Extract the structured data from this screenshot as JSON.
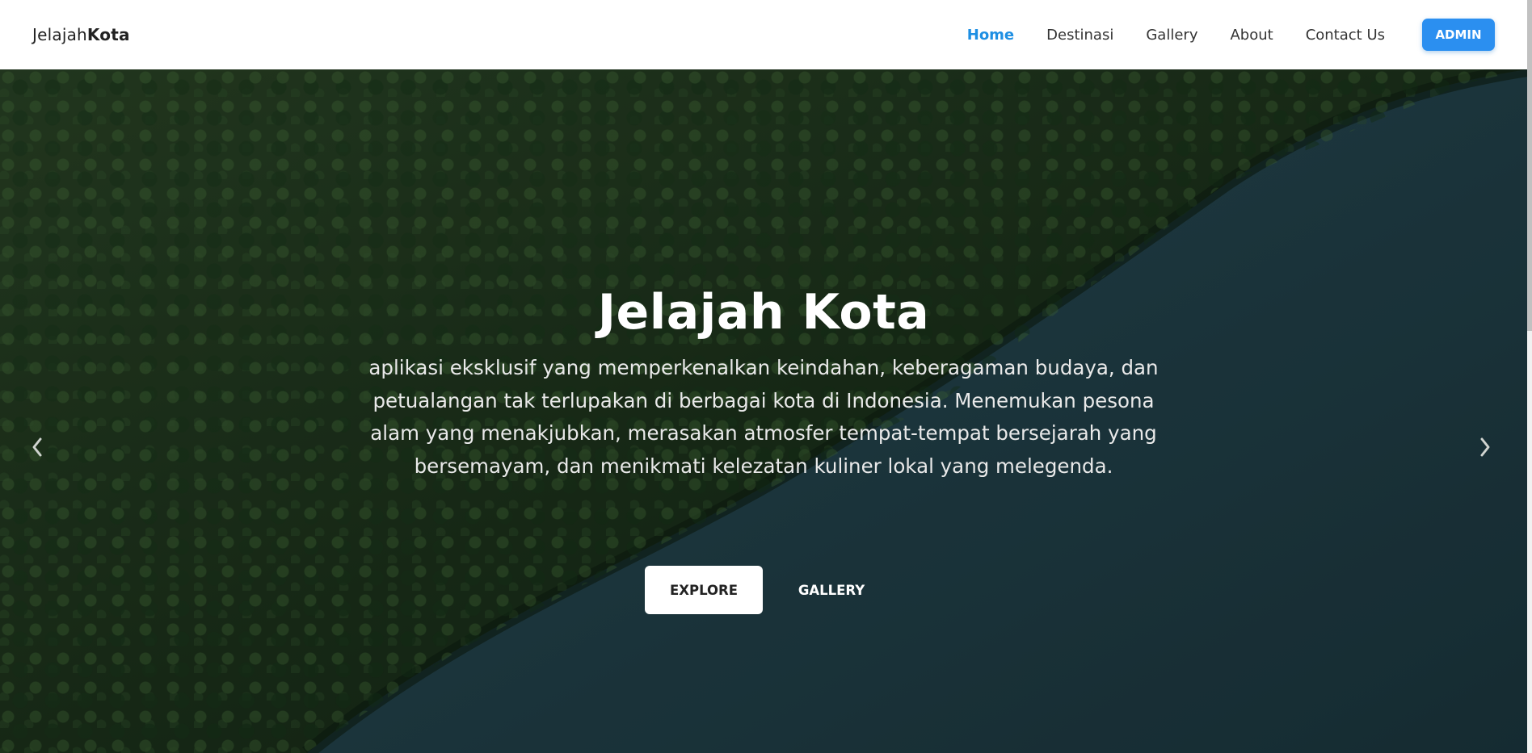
{
  "brand": {
    "prefix": "Jelajah",
    "bold": "Kota"
  },
  "nav": {
    "items": [
      {
        "label": "Home",
        "active": true
      },
      {
        "label": "Destinasi",
        "active": false
      },
      {
        "label": "Gallery",
        "active": false
      },
      {
        "label": "About",
        "active": false
      },
      {
        "label": "Contact Us",
        "active": false
      }
    ],
    "admin_label": "ADMIN"
  },
  "hero": {
    "title": "Jelajah Kota",
    "description": "aplikasi eksklusif yang memperkenalkan keindahan, keberagaman budaya, dan petualangan tak terlupakan di berbagai kota di Indonesia. Menemukan pesona alam yang menakjubkan, merasakan atmosfer tempat-tempat bersejarah yang bersemayam, dan menikmati kelezatan kuliner lokal yang melegenda.",
    "explore_label": "EXPLORE",
    "gallery_label": "GALLERY"
  },
  "carousel": {
    "prev_icon": "chevron-left-icon",
    "next_icon": "chevron-right-icon"
  },
  "colors": {
    "accent": "#1e8fe3",
    "admin_button": "#2b8ff0",
    "forest": "#1f3a1f",
    "water": "#23424a"
  }
}
